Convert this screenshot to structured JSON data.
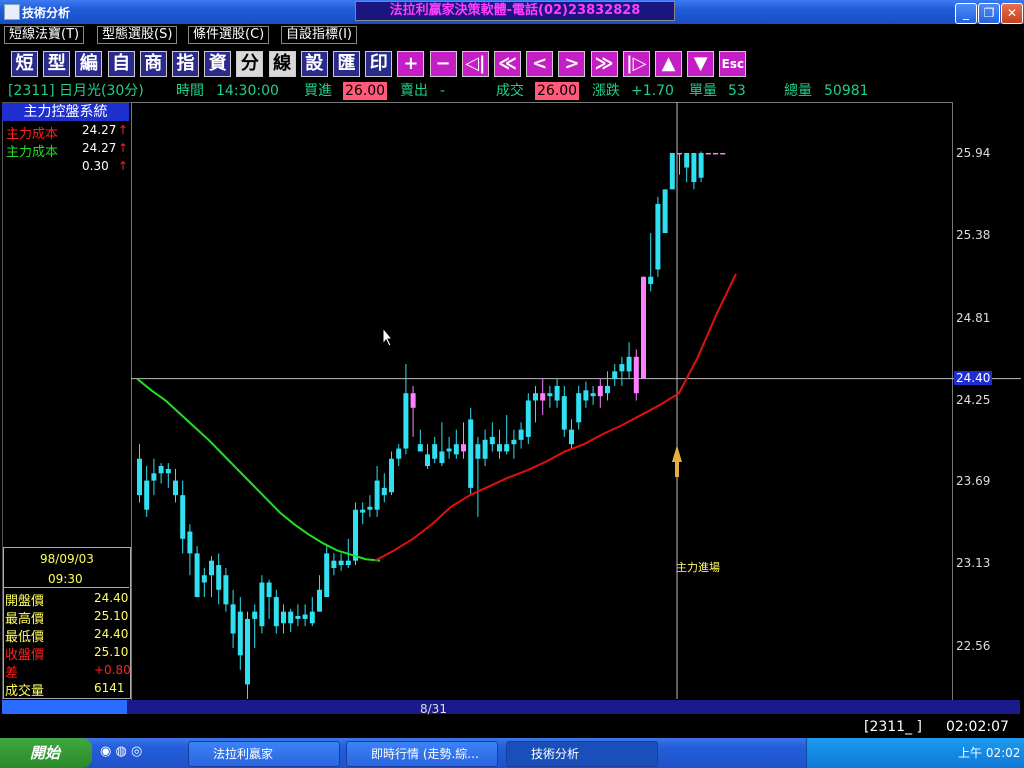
{
  "window": {
    "title": "技術分析",
    "banner": "法拉利贏家決策軟體-電話(02)23832828",
    "buttons": {
      "minimize": "_",
      "maximize": "❐",
      "close": "✕"
    }
  },
  "menu": [
    "短線法寶(T)",
    "型態選股(S)",
    "條件選股(C)",
    "自設指標(I)"
  ],
  "toolbar": [
    {
      "label": "短",
      "style": "dark"
    },
    {
      "label": "型",
      "style": "dark"
    },
    {
      "label": "編",
      "style": "dark"
    },
    {
      "label": "自",
      "style": "dark"
    },
    {
      "label": "商",
      "style": "dark"
    },
    {
      "label": "指",
      "style": "dark"
    },
    {
      "label": "資",
      "style": "dark"
    },
    {
      "label": "分",
      "style": "light"
    },
    {
      "label": "線",
      "style": "light"
    },
    {
      "label": "設",
      "style": "dark"
    },
    {
      "label": "匯",
      "style": "dark"
    },
    {
      "label": "印",
      "style": "dark"
    },
    {
      "label": "+",
      "style": "mag"
    },
    {
      "label": "−",
      "style": "mag"
    },
    {
      "label": "◁|",
      "style": "mag"
    },
    {
      "label": "≪",
      "style": "mag"
    },
    {
      "label": "<",
      "style": "mag"
    },
    {
      "label": ">",
      "style": "mag"
    },
    {
      "label": "≫",
      "style": "mag"
    },
    {
      "label": "|▷",
      "style": "mag"
    },
    {
      "label": "▲",
      "style": "mag"
    },
    {
      "label": "▼",
      "style": "mag"
    },
    {
      "label": "Esc",
      "style": "mag"
    }
  ],
  "info": {
    "code": "[2311] 日月光(30分)",
    "time_label": "時間",
    "time_value": "14:30:00",
    "bid_label": "買進",
    "bid_value": "26.00",
    "ask_label": "賣出",
    "ask_value": "-",
    "deal_label": "成交",
    "deal_value": "26.00",
    "change_label": "漲跌",
    "change_value": "+1.70",
    "vol_label": "單量",
    "vol_value": "53",
    "total_label": "總量",
    "total_value": "50981"
  },
  "left_panel": {
    "title": "主力控盤系統",
    "rows": [
      {
        "label": "主力成本",
        "value": "24.27",
        "arrow": "↑",
        "color": "#ff2020"
      },
      {
        "label": "主力成本",
        "value": "24.27",
        "arrow": "↑",
        "color": "#20e020"
      },
      {
        "label": "",
        "value": "0.30",
        "arrow": "↑",
        "color": "#ffffff"
      }
    ]
  },
  "data_box": {
    "date": "98/09/03",
    "time": "09:30",
    "rows": [
      {
        "label": "開盤價",
        "value": "24.40",
        "color": "#ffff60",
        "vcolor": "#ffff60"
      },
      {
        "label": "最高價",
        "value": "25.10",
        "color": "#ffff60",
        "vcolor": "#ffff60"
      },
      {
        "label": "最低價",
        "value": "24.40",
        "color": "#ffff60",
        "vcolor": "#ffff60"
      },
      {
        "label": "收盤價",
        "value": "25.10",
        "color": "#ff2020",
        "vcolor": "#ffff60"
      },
      {
        "label": "差",
        "value": "+0.80",
        "color": "#ff2020",
        "vcolor": "#ff2020"
      },
      {
        "label": "成交量",
        "value": "6141",
        "color": "#ffff60",
        "vcolor": "#ffff60"
      }
    ]
  },
  "chart_data": {
    "type": "candlestick",
    "yticks": [
      "25.94",
      "25.38",
      "24.81",
      "24.40",
      "24.25",
      "23.69",
      "23.13",
      "22.56"
    ],
    "ylim": [
      22.2,
      26.3
    ],
    "crosshair_price": "24.40",
    "x_label": "8/31",
    "annotation": "主力進場",
    "candles": [
      [
        23.85,
        23.95,
        23.55,
        23.6
      ],
      [
        23.7,
        23.8,
        23.45,
        23.5
      ],
      [
        23.75,
        23.85,
        23.6,
        23.7
      ],
      [
        23.8,
        23.82,
        23.68,
        23.75
      ],
      [
        23.78,
        23.82,
        23.65,
        23.75
      ],
      [
        23.7,
        23.78,
        23.55,
        23.6
      ],
      [
        23.6,
        23.7,
        23.2,
        23.3
      ],
      [
        23.35,
        23.4,
        23.05,
        23.2
      ],
      [
        23.2,
        23.25,
        22.9,
        22.9
      ],
      [
        23.05,
        23.1,
        22.9,
        23.0
      ],
      [
        23.15,
        23.18,
        22.9,
        23.05
      ],
      [
        23.12,
        23.2,
        22.85,
        22.95
      ],
      [
        23.05,
        23.1,
        22.8,
        22.85
      ],
      [
        22.85,
        22.95,
        22.55,
        22.65
      ],
      [
        22.8,
        22.9,
        22.4,
        22.5
      ],
      [
        22.75,
        22.8,
        22.2,
        22.3
      ],
      [
        22.75,
        22.85,
        22.55,
        22.8
      ],
      [
        23.0,
        23.05,
        22.65,
        22.7
      ],
      [
        23.0,
        23.02,
        22.75,
        22.9
      ],
      [
        22.9,
        22.95,
        22.65,
        22.7
      ],
      [
        22.8,
        22.85,
        22.65,
        22.72
      ],
      [
        22.8,
        22.82,
        22.66,
        22.72
      ],
      [
        22.75,
        22.85,
        22.7,
        22.77
      ],
      [
        22.75,
        22.85,
        22.7,
        22.78
      ],
      [
        22.8,
        22.9,
        22.7,
        22.72
      ],
      [
        22.95,
        23.05,
        22.8,
        22.8
      ],
      [
        23.2,
        23.25,
        22.9,
        22.9
      ],
      [
        23.15,
        23.2,
        23.05,
        23.1
      ],
      [
        23.12,
        23.2,
        23.08,
        23.15
      ],
      [
        23.15,
        23.3,
        23.1,
        23.12
      ],
      [
        23.5,
        23.55,
        23.12,
        23.15
      ],
      [
        23.5,
        23.55,
        23.4,
        23.48
      ],
      [
        23.52,
        23.6,
        23.45,
        23.5
      ],
      [
        23.7,
        23.8,
        23.45,
        23.5
      ],
      [
        23.65,
        23.75,
        23.55,
        23.6
      ],
      [
        23.85,
        23.9,
        23.6,
        23.62
      ],
      [
        23.92,
        23.95,
        23.8,
        23.85
      ],
      [
        24.3,
        24.5,
        23.88,
        23.92
      ],
      [
        24.2,
        24.35,
        24.0,
        24.3
      ],
      [
        23.95,
        24.05,
        23.9,
        23.9
      ],
      [
        23.88,
        23.95,
        23.78,
        23.8
      ],
      [
        23.95,
        24.0,
        23.82,
        23.85
      ],
      [
        23.9,
        24.1,
        23.8,
        23.82
      ],
      [
        23.92,
        24.0,
        23.85,
        23.9
      ],
      [
        23.95,
        24.05,
        23.85,
        23.88
      ],
      [
        23.9,
        24.1,
        23.85,
        23.95
      ],
      [
        24.12,
        24.2,
        23.6,
        23.65
      ],
      [
        23.95,
        24.0,
        23.45,
        23.85
      ],
      [
        23.98,
        24.05,
        23.8,
        23.85
      ],
      [
        24.0,
        24.1,
        23.9,
        23.95
      ],
      [
        23.95,
        24.05,
        23.85,
        23.9
      ],
      [
        23.95,
        24.15,
        23.88,
        23.9
      ],
      [
        23.98,
        24.05,
        23.85,
        23.95
      ],
      [
        24.05,
        24.1,
        23.92,
        23.98
      ],
      [
        24.25,
        24.3,
        23.95,
        24.0
      ],
      [
        24.3,
        24.35,
        24.1,
        24.25
      ],
      [
        24.25,
        24.4,
        24.15,
        24.3
      ],
      [
        24.3,
        24.35,
        24.2,
        24.28
      ],
      [
        24.35,
        24.4,
        24.2,
        24.25
      ],
      [
        24.28,
        24.35,
        24.0,
        24.05
      ],
      [
        24.05,
        24.12,
        23.92,
        23.95
      ],
      [
        24.3,
        24.35,
        24.05,
        24.1
      ],
      [
        24.32,
        24.38,
        24.2,
        24.25
      ],
      [
        24.3,
        24.35,
        24.22,
        24.28
      ],
      [
        24.28,
        24.4,
        24.2,
        24.35
      ],
      [
        24.35,
        24.45,
        24.25,
        24.3
      ],
      [
        24.45,
        24.5,
        24.35,
        24.4
      ],
      [
        24.5,
        24.55,
        24.35,
        24.45
      ],
      [
        24.55,
        24.65,
        24.4,
        24.45
      ],
      [
        24.3,
        24.6,
        24.25,
        24.55
      ],
      [
        24.4,
        25.1,
        24.4,
        25.1
      ],
      [
        25.1,
        25.4,
        25.0,
        25.05
      ],
      [
        25.6,
        25.65,
        25.1,
        25.15
      ],
      [
        25.7,
        25.7,
        25.4,
        25.4
      ],
      [
        25.95,
        25.95,
        25.7,
        25.7
      ],
      [
        25.95,
        25.95,
        25.8,
        25.95
      ],
      [
        25.95,
        25.95,
        25.75,
        25.85
      ],
      [
        25.95,
        25.95,
        25.7,
        25.75
      ],
      [
        25.95,
        25.96,
        25.75,
        25.78
      ],
      [
        25.95,
        25.95,
        25.95,
        25.95
      ],
      [
        25.95,
        25.95,
        25.95,
        25.95
      ],
      [
        25.95,
        25.95,
        25.95,
        25.95
      ]
    ],
    "ma_green": [
      24.4,
      24.32,
      24.25,
      24.16,
      24.07,
      23.98,
      23.88,
      23.78,
      23.68,
      23.58,
      23.48,
      23.4,
      23.33,
      23.27,
      23.22,
      23.19,
      23.16,
      23.15
    ],
    "ma_red": [
      23.15,
      23.22,
      23.3,
      23.4,
      23.52,
      23.6,
      23.66,
      23.72,
      23.77,
      23.83,
      23.9,
      23.95,
      24.02,
      24.08,
      24.15,
      24.22,
      24.3,
      24.55,
      24.85,
      25.12
    ]
  },
  "status": {
    "code_box": "[2311_ ]",
    "clock": "02:02:07"
  },
  "taskbar": {
    "start": "開始",
    "tasks": [
      "法拉利贏家",
      "即時行情 (走勢.綜...",
      "技術分析"
    ],
    "clock": "上午 02:02"
  }
}
